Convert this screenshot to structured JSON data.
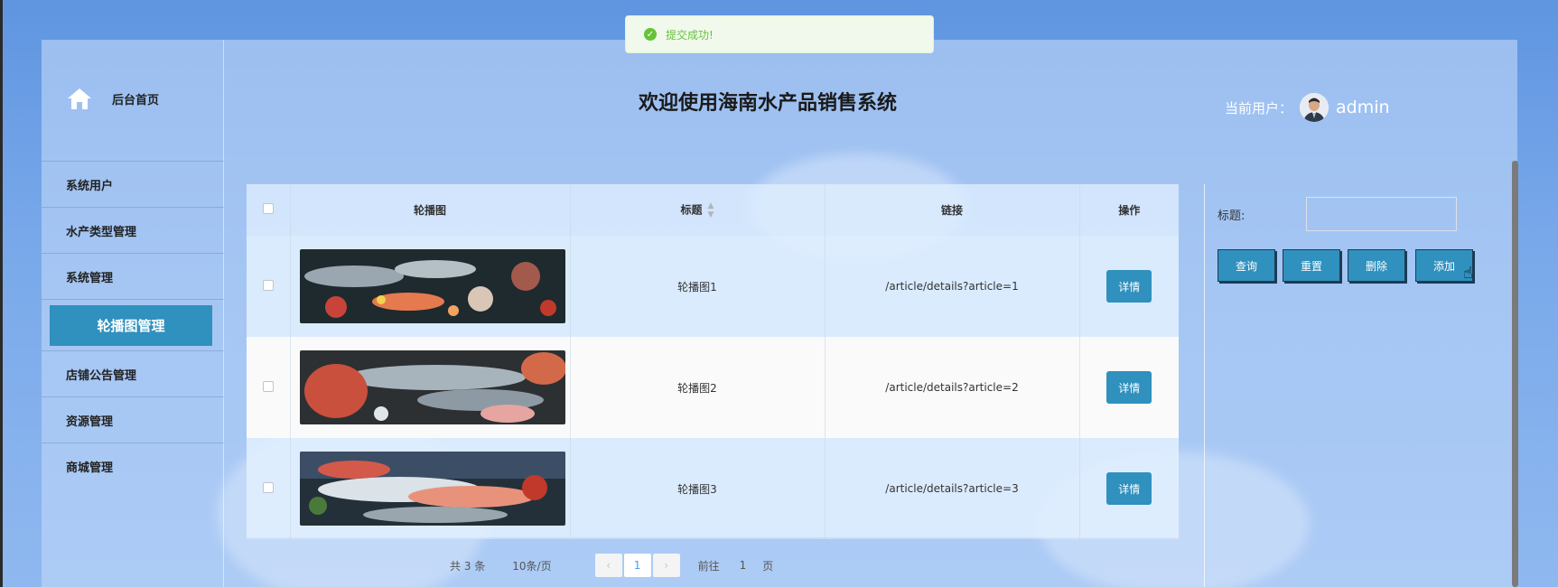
{
  "toast": {
    "message": "提交成功!"
  },
  "sidebar": {
    "home_label": "后台首页",
    "items": [
      {
        "label": "系统用户"
      },
      {
        "label": "水产类型管理"
      },
      {
        "label": "系统管理"
      },
      {
        "label": "轮播图管理",
        "active": true
      },
      {
        "label": "店铺公告管理"
      },
      {
        "label": "资源管理"
      },
      {
        "label": "商城管理"
      }
    ]
  },
  "header": {
    "title": "欢迎使用海南水产品销售系统",
    "user_label": "当前用户：",
    "username": "admin"
  },
  "table": {
    "columns": [
      "轮播图",
      "标题",
      "链接",
      "操作"
    ],
    "rows": [
      {
        "title": "轮播图1",
        "link": "/article/details?article=1",
        "action": "详情"
      },
      {
        "title": "轮播图2",
        "link": "/article/details?article=2",
        "action": "详情"
      },
      {
        "title": "轮播图3",
        "link": "/article/details?article=3",
        "action": "详情"
      }
    ]
  },
  "pagination": {
    "total": "共 3 条",
    "page_size": "10条/页",
    "current_page": "1",
    "goto_label": "前往",
    "goto_value": "1",
    "page_suffix": "页"
  },
  "filter": {
    "label": "标题:",
    "value": "",
    "buttons": {
      "query": "查询",
      "reset": "重置",
      "delete": "删除",
      "add": "添加"
    }
  },
  "colors": {
    "accent": "#3090be",
    "success": "#67c23a"
  }
}
